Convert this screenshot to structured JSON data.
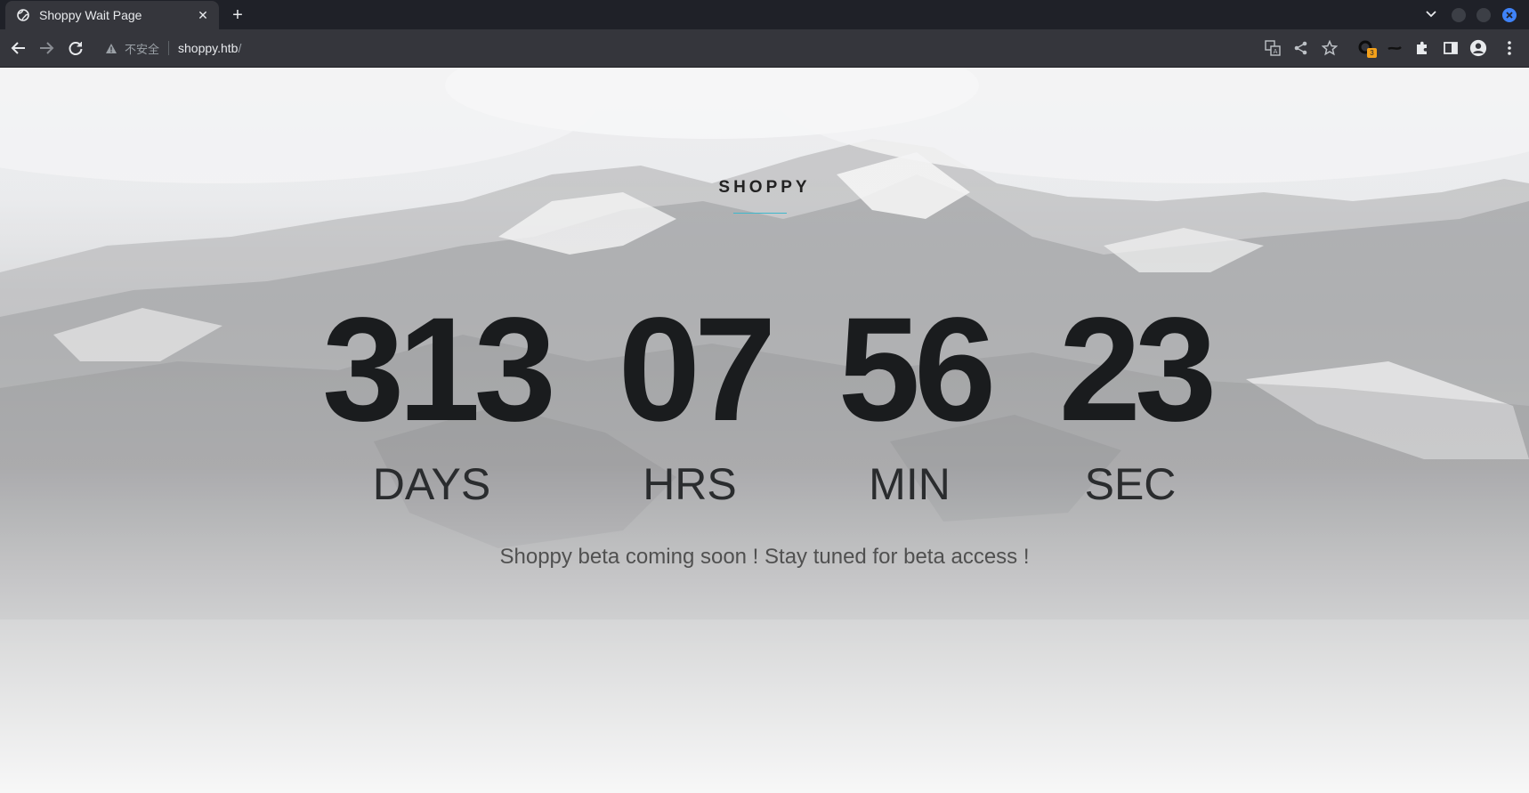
{
  "browser": {
    "tab_title": "Shoppy Wait Page",
    "security_text": "不安全",
    "url_host": "shoppy.htb",
    "url_path": "/",
    "extension_badge": "3"
  },
  "page": {
    "brand": "SHOPPY",
    "countdown": [
      {
        "value": "313",
        "unit": "DAYS"
      },
      {
        "value": "07",
        "unit": "HRS"
      },
      {
        "value": "56",
        "unit": "MIN"
      },
      {
        "value": "23",
        "unit": "SEC"
      }
    ],
    "subtitle": "Shoppy beta coming soon ! Stay tuned for beta access !"
  },
  "colors": {
    "brand_underline": "#3fb8cc",
    "digits": "#1a1c1e",
    "chrome_dark": "#1f2128",
    "chrome_toolbar": "#35363c"
  }
}
